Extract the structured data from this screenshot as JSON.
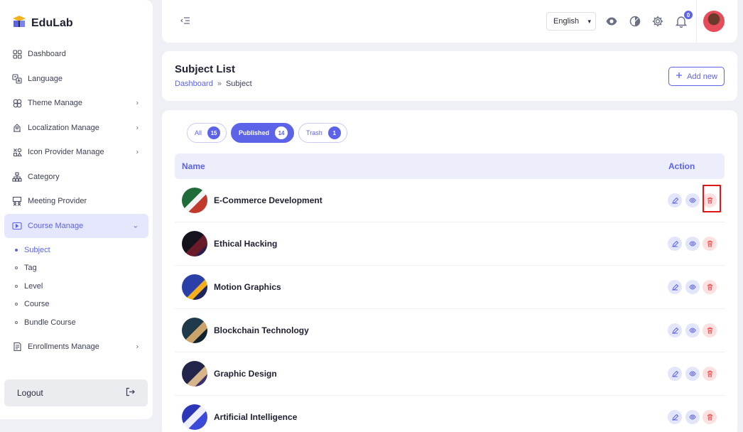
{
  "brand": {
    "name": "EduLab"
  },
  "sidebar": {
    "items": [
      {
        "label": "Dashboard",
        "icon": "grid-icon",
        "chevron": false
      },
      {
        "label": "Language",
        "icon": "translate-icon",
        "chevron": false
      },
      {
        "label": "Theme Manage",
        "icon": "theme-icon",
        "chevron": true
      },
      {
        "label": "Localization Manage",
        "icon": "localization-icon",
        "chevron": true
      },
      {
        "label": "Icon Provider Manage",
        "icon": "shapes-icon",
        "chevron": true
      },
      {
        "label": "Category",
        "icon": "sitemap-icon",
        "chevron": false
      },
      {
        "label": "Meeting Provider",
        "icon": "meeting-icon",
        "chevron": false
      },
      {
        "label": "Course Manage",
        "icon": "video-icon",
        "chevron": true,
        "expanded": true
      }
    ],
    "course_sub": [
      {
        "label": "Subject",
        "active": true
      },
      {
        "label": "Tag",
        "active": false
      },
      {
        "label": "Level",
        "active": false
      },
      {
        "label": "Course",
        "active": false
      },
      {
        "label": "Bundle Course",
        "active": false
      }
    ],
    "after_items": [
      {
        "label": "Enrollments Manage",
        "icon": "enrollment-icon",
        "chevron": true
      }
    ],
    "logout_label": "Logout"
  },
  "topbar": {
    "language": "English",
    "notification_count": "0"
  },
  "header": {
    "title": "Subject List",
    "breadcrumb": {
      "link": "Dashboard",
      "separator": "»",
      "current": "Subject"
    },
    "add_new_label": "Add new"
  },
  "tabs": [
    {
      "label": "All",
      "count": "15",
      "active": false
    },
    {
      "label": "Published",
      "count": "14",
      "active": true
    },
    {
      "label": "Trash",
      "count": "1",
      "active": false
    }
  ],
  "table": {
    "headers": {
      "name": "Name",
      "action": "Action"
    },
    "rows": [
      {
        "name": "E-Commerce Development"
      },
      {
        "name": "Ethical Hacking"
      },
      {
        "name": "Motion Graphics"
      },
      {
        "name": "Blockchain Technology"
      },
      {
        "name": "Graphic Design"
      },
      {
        "name": "Artificial Intelligence"
      }
    ]
  },
  "colors": {
    "accent": "#5c63e8",
    "danger": "#ea5455",
    "highlight": "#e01515"
  }
}
